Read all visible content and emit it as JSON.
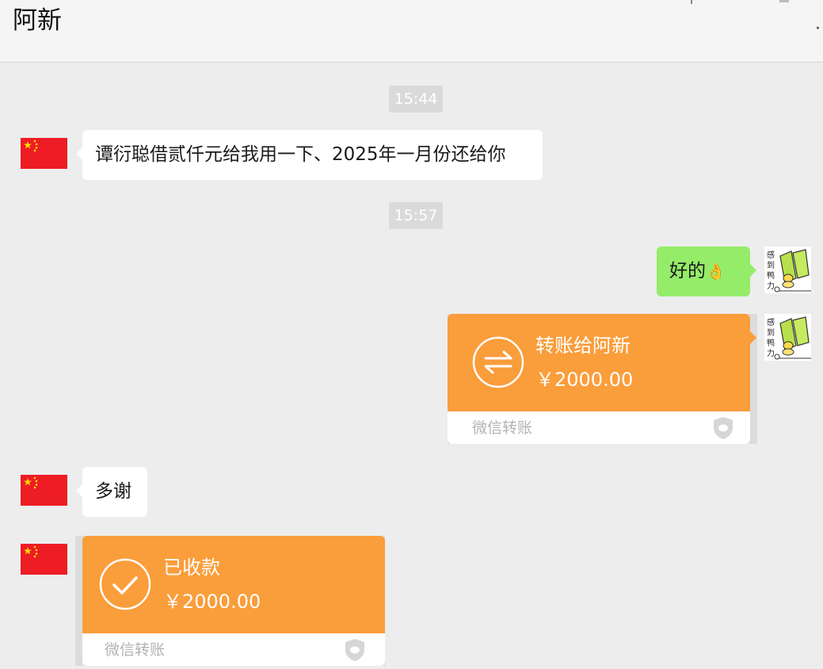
{
  "header": {
    "title": "阿新",
    "more_glyph": "·"
  },
  "timestamps": [
    "15:44",
    "15:57"
  ],
  "messages": {
    "m1": "谭衍聪借贰仟元给我用一下、2025年一月份还给你",
    "m2": "好的",
    "m2_emoji": "👌",
    "m3": "多谢"
  },
  "transfer_sent": {
    "title": "转账给阿新",
    "amount": "￥2000.00",
    "footer": "微信转账",
    "icon": "transfer-arrows-icon"
  },
  "transfer_received": {
    "title": "已收款",
    "amount": "￥2000.00",
    "footer": "微信转账",
    "icon": "check-circle-icon"
  },
  "avatars": {
    "contact": "china-flag-avatar",
    "self": "duck-sticker-avatar"
  },
  "colors": {
    "background": "#ededed",
    "bubble_self": "#95ec69",
    "transfer": "#fa9d3b",
    "flag_red": "#ee1c25",
    "flag_star": "#ffde00"
  }
}
